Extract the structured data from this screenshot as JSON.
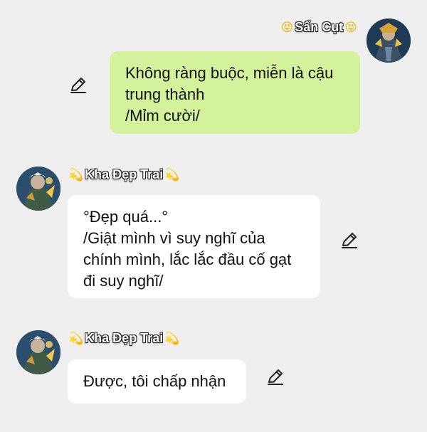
{
  "messages": [
    {
      "sender": "Sẩn Cụt",
      "sender_emoji_left": "😝",
      "sender_emoji_right": "😝",
      "side": "right",
      "text": "Không ràng buộc, miễn là cậu\ntrung thành\n/Mỉm cười/",
      "bubble_color": "#d4f29b",
      "edit_icon": "pencil-icon"
    },
    {
      "sender": "Kha Đẹp Trai",
      "sender_emoji_left": "💫",
      "sender_emoji_right": "💫",
      "side": "left",
      "text": "°Đẹp quá...°\n/Giật mình vì suy nghĩ của\nchính mình, lắc lắc đầu cố gạt\nđi suy nghĩ/",
      "bubble_color": "#ffffff",
      "edit_icon": "pencil-icon"
    },
    {
      "sender": "Kha Đẹp Trai",
      "sender_emoji_left": "💫",
      "sender_emoji_right": "💫",
      "side": "left",
      "text": "Được, tôi chấp nhận",
      "bubble_color": "#ffffff",
      "edit_icon": "pencil-icon"
    }
  ],
  "background_color": "#efefef"
}
